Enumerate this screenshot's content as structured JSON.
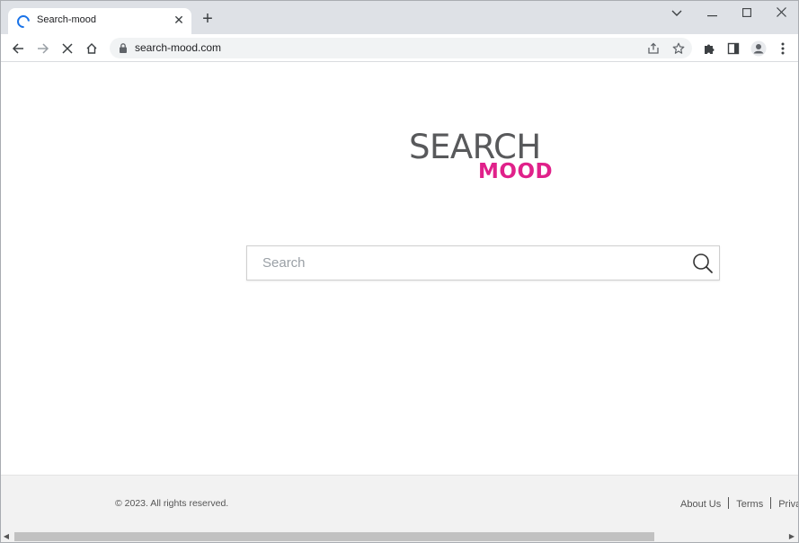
{
  "browser": {
    "tab": {
      "title": "Search-mood",
      "close_glyph": "✕"
    },
    "new_tab_glyph": "+",
    "window_controls": {
      "tab_search": "⌵",
      "minimize": "—",
      "maximize": "☐",
      "close": "✕"
    },
    "address": {
      "url": "search-mood.com"
    },
    "icons": {
      "back": "arrow-left-icon",
      "forward": "arrow-right-icon",
      "stop": "close-icon",
      "home": "home-icon",
      "lock": "lock-icon",
      "share": "share-icon",
      "bookmark": "star-icon",
      "extensions": "puzzle-icon",
      "side_panel": "side-panel-icon",
      "profile": "profile-icon",
      "menu": "kebab-menu-icon"
    }
  },
  "page": {
    "logo": {
      "line1": "SEARCH",
      "line2": "MOOD",
      "color_primary": "#58595b",
      "color_accent": "#e0218a"
    },
    "search": {
      "placeholder": "Search",
      "value": ""
    },
    "footer": {
      "copyright": "© 2023. All rights reserved.",
      "links": [
        "About Us",
        "Terms",
        "Privac"
      ]
    }
  },
  "scrollbar": {
    "left_arrow": "◀",
    "right_arrow": "▶"
  }
}
